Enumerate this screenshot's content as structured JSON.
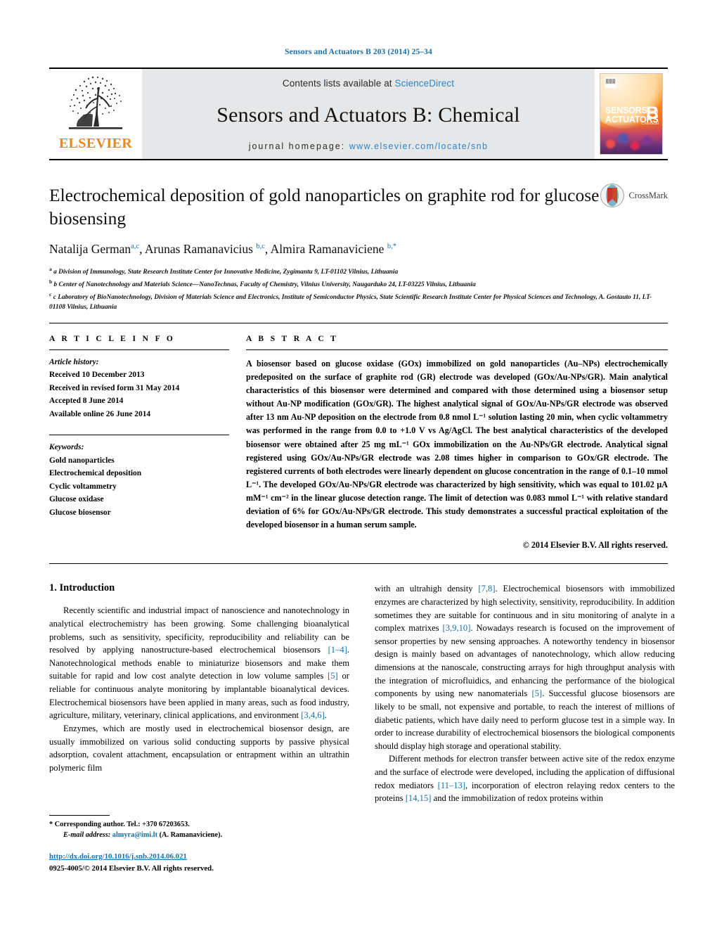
{
  "running_head": "Sensors and Actuators B 203 (2014) 25–34",
  "masthead": {
    "contents_prefix": "Contents lists available at ",
    "sciencedirect": "ScienceDirect",
    "journal_title": "Sensors and Actuators B: Chemical",
    "homepage_prefix": "journal homepage: ",
    "homepage_url": "www.elsevier.com/locate/snb",
    "publisher": "ELSEVIER",
    "cover": {
      "line1": "SENSORS",
      "line1_small": "and",
      "line2": "ACTUATORS",
      "letter": "B",
      "letter_sub": "Chemical"
    }
  },
  "article": {
    "title": "Electrochemical deposition of gold nanoparticles on graphite rod for glucose biosensing",
    "crossmark_label": "CrossMark",
    "authors_html": "Natalija German<sup>a,c</sup>, Arunas Ramanavicius <sup>b,c</sup>, Almira Ramanaviciene <sup>b,*</sup>",
    "affiliations": [
      "a Division of Immunology, State Research Institute Center for Innovative Medicine, Zygimantu 9, LT-01102 Vilnius, Lithuania",
      "b Center of Nanotechnology and Materials Science—NanoTechnas, Faculty of Chemistry, Vilnius University, Naugarduko 24, LT-03225 Vilnius, Lithuania",
      "c Laboratory of BioNanotechnology, Division of Materials Science and Electronics, Institute of Semiconductor Physics, State Scientific Research Institute Center for Physical Sciences and Technology, A. Gostauto 11, LT-01108 Vilnius, Lithuania"
    ]
  },
  "article_info": {
    "heading": "A R T I C L E   I N F O",
    "history_label": "Article history:",
    "history": [
      "Received 10 December 2013",
      "Received in revised form 31 May 2014",
      "Accepted 8 June 2014",
      "Available online 26 June 2014"
    ],
    "keywords_label": "Keywords:",
    "keywords": [
      "Gold nanoparticles",
      "Electrochemical deposition",
      "Cyclic voltammetry",
      "Glucose oxidase",
      "Glucose biosensor"
    ]
  },
  "abstract": {
    "heading": "A B S T R A C T",
    "text": "A biosensor based on glucose oxidase (GOx) immobilized on gold nanoparticles (Au–NPs) electrochemically predeposited on the surface of graphite rod (GR) electrode was developed (GOx/Au-NPs/GR). Main analytical characteristics of this biosensor were determined and compared with those determined using a biosensor setup without Au-NP modification (GOx/GR). The highest analytical signal of GOx/Au-NPs/GR electrode was observed after 13 nm Au-NP deposition on the electrode from 0.8 nmol L⁻¹ solution lasting 20 min, when cyclic voltammetry was performed in the range from 0.0 to +1.0 V vs Ag/AgCl. The best analytical characteristics of the developed biosensor were obtained after 25 mg mL⁻¹ GOx immobilization on the Au-NPs/GR electrode. Analytical signal registered using GOx/Au-NPs/GR electrode was 2.08 times higher in comparison to GOx/GR electrode. The registered currents of both electrodes were linearly dependent on glucose concentration in the range of 0.1–10 mmol L⁻¹. The developed GOx/Au-NPs/GR electrode was characterized by high sensitivity, which was equal to 101.02 μA mM⁻¹ cm⁻² in the linear glucose detection range. The limit of detection was 0.083 mmol L⁻¹ with relative standard deviation of 6% for GOx/Au-NPs/GR electrode. This study demonstrates a successful practical exploitation of the developed biosensor in a human serum sample.",
    "copyright": "© 2014 Elsevier B.V. All rights reserved."
  },
  "introduction": {
    "heading": "1.  Introduction",
    "left_paragraphs": [
      "Recently scientific and industrial impact of nanoscience and nanotechnology in analytical electrochemistry has been growing. Some challenging bioanalytical problems, such as sensitivity, specificity, reproducibility and reliability can be resolved by applying nanostructure-based electrochemical biosensors [1–4]. Nanotechnological methods enable to miniaturize biosensors and make them suitable for rapid and low cost analyte detection in low volume samples [5] or reliable for continuous analyte monitoring by implantable bioanalytical devices. Electrochemical biosensors have been applied in many areas, such as food industry, agriculture, military, veterinary, clinical applications, and environment [3,4,6].",
      "Enzymes, which are mostly used in electrochemical biosensor design, are usually immobilized on various solid conducting supports by passive physical adsorption, covalent attachment, encapsulation or entrapment within an ultrathin polymeric film"
    ],
    "right_paragraphs": [
      "with an ultrahigh density [7,8]. Electrochemical biosensors with immobilized enzymes are characterized by high selectivity, sensitivity, reproducibility. In addition sometimes they are suitable for continuous and in situ monitoring of analyte in a complex matrixes [3,9,10]. Nowadays research is focused on the improvement of sensor properties by new sensing approaches. A noteworthy tendency in biosensor design is mainly based on advantages of nanotechnology, which allow reducing dimensions at the nanoscale, constructing arrays for high throughput analysis with the integration of microfluidics, and enhancing the performance of the biological components by using new nanomaterials [5]. Successful glucose biosensors are likely to be small, not expensive and portable, to reach the interest of millions of diabetic patients, which have daily need to perform glucose test in a simple way. In order to increase durability of electrochemical biosensors the biological components should display high storage and operational stability.",
      "Different methods for electron transfer between active site of the redox enzyme and the surface of electrode were developed, including the application of diffusional redox mediators [11–13], incorporation of electron relaying redox centers to the proteins [14,15] and the immobilization of redox proteins within"
    ]
  },
  "footnote": {
    "corresponding": "* Corresponding author. Tel.: +370 67203653.",
    "email_label": "E-mail address:",
    "email": "almyra@imi.lt",
    "email_suffix": "(A. Ramanaviciene).",
    "doi": "http://dx.doi.org/10.1016/j.snb.2014.06.021",
    "issn_line": "0925-4005/© 2014 Elsevier B.V. All rights reserved."
  },
  "colors": {
    "link": "#1a6fa8",
    "elsevier_orange": "#ea8620",
    "masthead_bg": "#e6e7e8"
  }
}
